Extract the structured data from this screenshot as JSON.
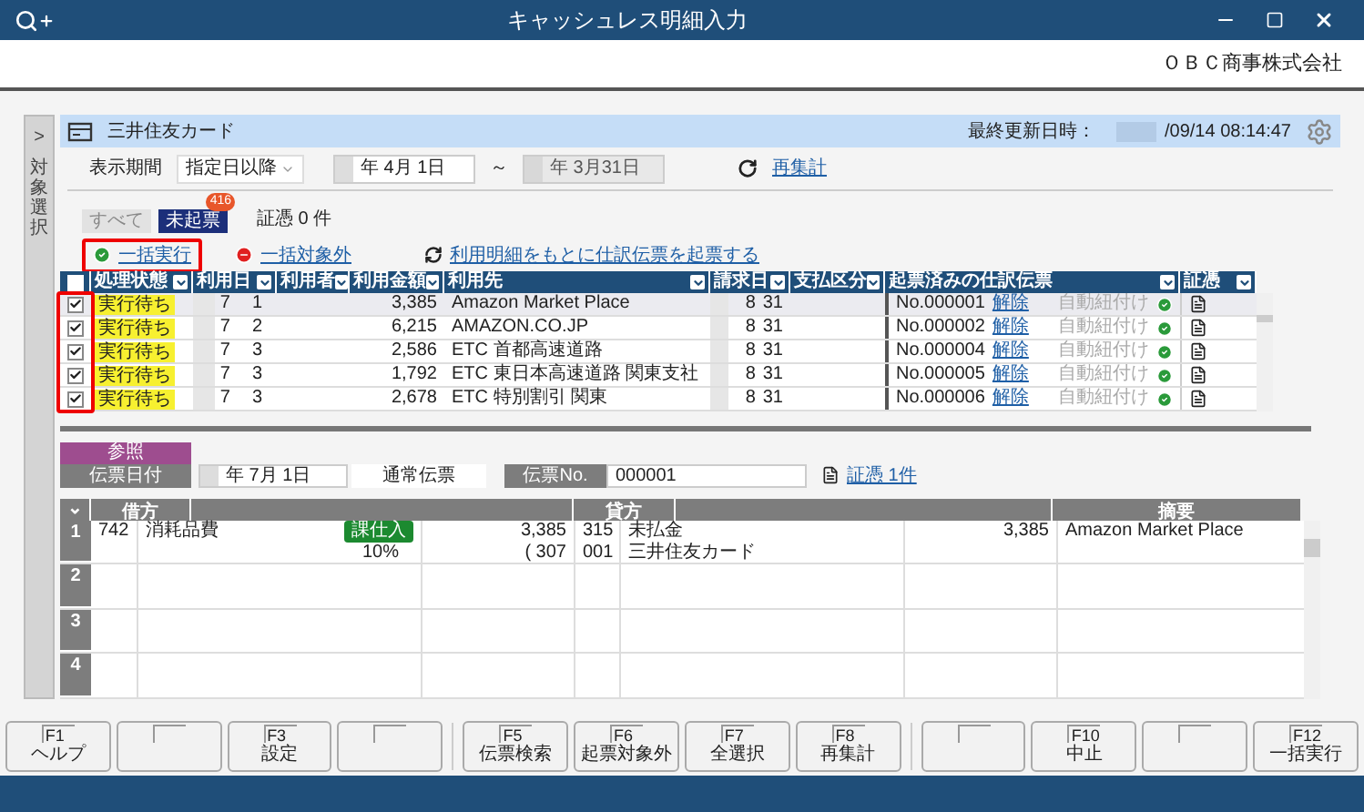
{
  "window": {
    "title": "キャッシュレス明細入力",
    "company": "ＯＢＣ商事株式会社"
  },
  "side_tab": {
    "arrow": ">",
    "label": "対象選択"
  },
  "card": {
    "title": "三井住友カード",
    "updated_label": "最終更新日時：",
    "updated_value": "/09/14 08:14:47"
  },
  "filter": {
    "label": "表示期間",
    "mode": "指定日以降",
    "from": "年 4月 1日",
    "tilde": "～",
    "to": "年 3月31日",
    "recalc": "再集計"
  },
  "view_tabs": [
    {
      "label": "すべて",
      "selected": false
    },
    {
      "label": "未起票",
      "selected": true,
      "badge": "416"
    }
  ],
  "evidence_count": "証憑 0 件",
  "actions": [
    {
      "label": "一括実行",
      "kind": "ok",
      "highlighted": true
    },
    {
      "label": "一括対象外",
      "kind": "stop",
      "highlighted": false
    },
    {
      "label": "利用明細をもとに仕訳伝票を起票する",
      "kind": "sync",
      "highlighted": false
    }
  ],
  "table": {
    "checkbox_highlighted": true,
    "all_checked": false,
    "columns": [
      "処理状態",
      "利用日",
      "利用者",
      "利用金額",
      "利用先",
      "請求日",
      "支払区分",
      "起票済みの仕訳伝票",
      "証憑"
    ],
    "rows": [
      {
        "checked": true,
        "selected": true,
        "status": "実行待ち",
        "use_month": "7",
        "use_day": "1",
        "amount": "3,385",
        "payee": "Amazon Market Place",
        "bill_month": "8",
        "bill_day": "31",
        "voucher": "No.000001",
        "release": "解除",
        "auto": "自動紐付け"
      },
      {
        "checked": true,
        "selected": false,
        "status": "実行待ち",
        "use_month": "7",
        "use_day": "2",
        "amount": "6,215",
        "payee": "AMAZON.CO.JP",
        "bill_month": "8",
        "bill_day": "31",
        "voucher": "No.000002",
        "release": "解除",
        "auto": "自動紐付け"
      },
      {
        "checked": true,
        "selected": false,
        "status": "実行待ち",
        "use_month": "7",
        "use_day": "3",
        "amount": "2,586",
        "payee": "ETC 首都高速道路",
        "bill_month": "8",
        "bill_day": "31",
        "voucher": "No.000004",
        "release": "解除",
        "auto": "自動紐付け"
      },
      {
        "checked": true,
        "selected": false,
        "status": "実行待ち",
        "use_month": "7",
        "use_day": "3",
        "amount": "1,792",
        "payee": "ETC 東日本高速道路 関東支社",
        "bill_month": "8",
        "bill_day": "31",
        "voucher": "No.000005",
        "release": "解除",
        "auto": "自動紐付け"
      },
      {
        "checked": true,
        "selected": false,
        "status": "実行待ち",
        "use_month": "7",
        "use_day": "3",
        "amount": "2,678",
        "payee": "ETC 特別割引 関東",
        "bill_month": "8",
        "bill_day": "31",
        "voucher": "No.000006",
        "release": "解除",
        "auto": "自動紐付け"
      }
    ]
  },
  "journal": {
    "ref_tab": "参照",
    "date_label": "伝票日付",
    "date": "年 7月 1日",
    "type": "通常伝票",
    "no_label": "伝票No.",
    "no": "000001",
    "evidence_link": "証憑 1件",
    "columns": {
      "expand": "⌄",
      "debit": "借方",
      "credit": "貸方",
      "memo": "摘要"
    },
    "rows": [
      {
        "num": "1",
        "debit_code": "742",
        "debit_account": "消耗品費",
        "tax_tag": "課仕入",
        "tax_rate": "10%",
        "debit_amount": "3,385",
        "tax_amount": "( 307",
        "credit_code": "315",
        "credit_account": "未払金",
        "credit_sub_code": "001",
        "credit_sub": "三井住友カード",
        "credit_amount": "3,385",
        "memo": "Amazon Market Place"
      },
      {
        "num": "2"
      },
      {
        "num": "3"
      },
      {
        "num": "4"
      }
    ]
  },
  "function_keys": [
    {
      "kind": "key",
      "key": "F1",
      "label": "ヘルプ"
    },
    {
      "kind": "blank"
    },
    {
      "kind": "key",
      "key": "F3",
      "label": "設定"
    },
    {
      "kind": "blank"
    },
    {
      "kind": "key",
      "key": "F5",
      "label": "伝票検索"
    },
    {
      "kind": "key",
      "key": "F6",
      "label": "起票対象外"
    },
    {
      "kind": "key",
      "key": "F7",
      "label": "全選択"
    },
    {
      "kind": "key",
      "key": "F8",
      "label": "再集計"
    },
    {
      "kind": "blank"
    },
    {
      "kind": "key",
      "key": "F10",
      "label": "中止"
    },
    {
      "kind": "blank"
    },
    {
      "kind": "key",
      "key": "F12",
      "label": "一括実行"
    }
  ]
}
